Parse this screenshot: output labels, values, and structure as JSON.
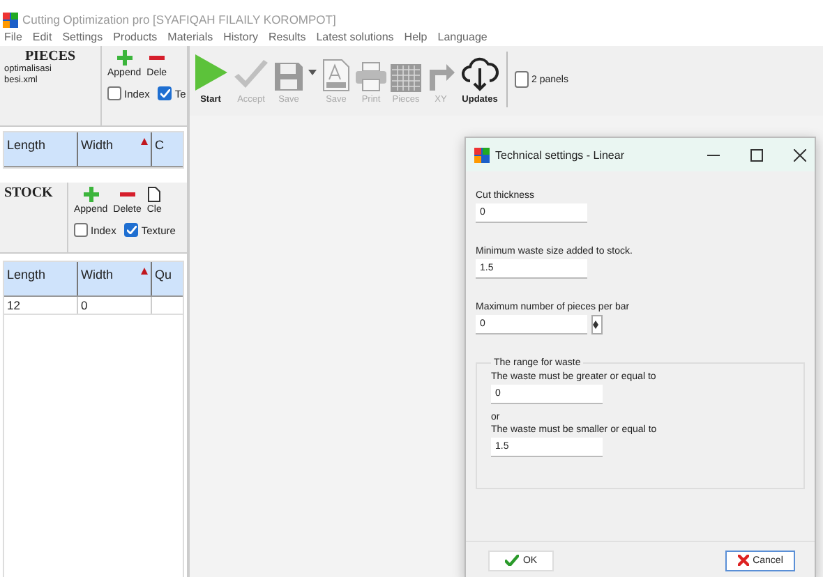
{
  "window": {
    "title": "Cutting Optimization pro [SYAFIQAH FILAILY KOROMPOT]"
  },
  "menu": [
    "File",
    "Edit",
    "Settings",
    "Products",
    "Materials",
    "History",
    "Results",
    "Latest solutions",
    "Help",
    "Language"
  ],
  "pieces": {
    "title": "PIECES",
    "file": "optimalisasi besi.xml",
    "buttons": [
      {
        "label": "Append",
        "kind": "add"
      },
      {
        "label": "Dele",
        "kind": "delete"
      }
    ],
    "options": [
      {
        "label": "Index",
        "checked": false
      },
      {
        "label": "Te",
        "checked": true
      }
    ],
    "columns": [
      {
        "label": "Length",
        "sorted": false
      },
      {
        "label": "Width",
        "sorted": true
      },
      {
        "label": "C",
        "sorted": false
      }
    ]
  },
  "stock": {
    "title": "STOCK",
    "buttons": [
      {
        "label": "Append",
        "kind": "add"
      },
      {
        "label": "Delete",
        "kind": "delete"
      },
      {
        "label": "Cle",
        "kind": "clear"
      }
    ],
    "options": [
      {
        "label": "Index",
        "checked": false
      },
      {
        "label": "Texture",
        "checked": true
      }
    ],
    "columns": [
      {
        "label": "Length",
        "sorted": false
      },
      {
        "label": "Width",
        "sorted": true
      },
      {
        "label": "Qu",
        "sorted": false
      }
    ],
    "rows": [
      [
        "12",
        "0"
      ]
    ]
  },
  "toolbar": [
    {
      "label": "Start",
      "kind": "start",
      "disabled": false
    },
    {
      "label": "Accept",
      "kind": "accept",
      "disabled": true
    },
    {
      "label": "Save",
      "kind": "save",
      "disabled": true
    },
    {
      "kind": "caret",
      "disabled": false
    },
    {
      "label": "Save",
      "kind": "document",
      "disabled": true
    },
    {
      "label": "Print",
      "kind": "print",
      "disabled": true
    },
    {
      "label": "Pieces",
      "kind": "grid",
      "disabled": true
    },
    {
      "label": "XY",
      "kind": "xy",
      "disabled": true
    },
    {
      "label": "Updates",
      "kind": "cloud",
      "disabled": false
    }
  ],
  "two_panels": {
    "label": "2 panels",
    "checked": false
  },
  "dialog": {
    "title": "Technical settings - Linear",
    "fields": [
      {
        "label": "Cut thickness",
        "value": "0",
        "kind": "text"
      },
      {
        "label": "Minimum waste size added to stock.",
        "value": "1.5",
        "kind": "text"
      },
      {
        "label": "Maximum number of pieces per bar",
        "value": "0",
        "kind": "spinner"
      }
    ],
    "group": {
      "title": "The range for waste",
      "items": [
        {
          "kind": "field",
          "label": "The waste must be greater or equal to",
          "value": "0"
        },
        {
          "kind": "note",
          "text": "or"
        },
        {
          "kind": "field",
          "label": "The waste must be smaller or equal to",
          "value": "1.5"
        }
      ]
    },
    "buttons": [
      {
        "label": "OK",
        "kind": "ok",
        "focused": false
      },
      {
        "label": "Cancel",
        "kind": "cancel",
        "focused": true
      }
    ]
  }
}
